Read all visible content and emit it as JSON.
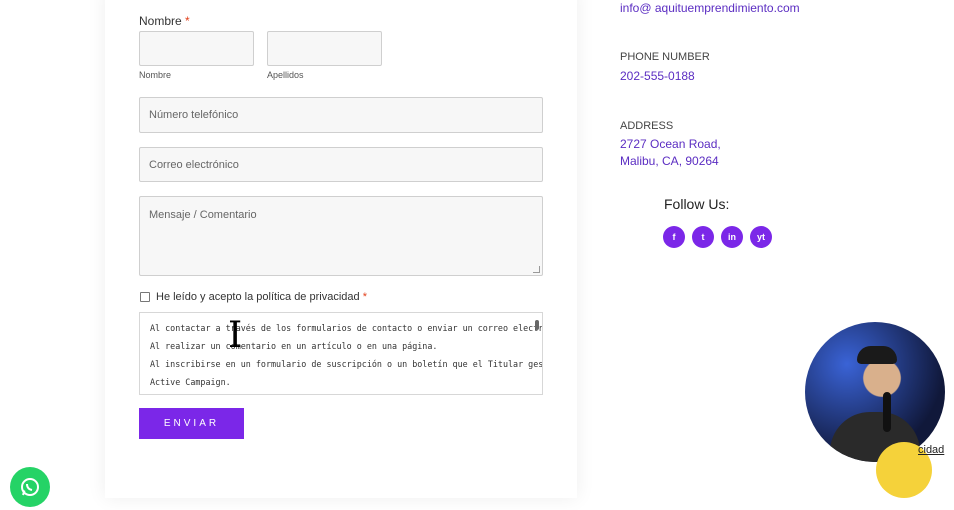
{
  "form": {
    "name_label": "Nombre",
    "required_mark": "*",
    "first_name_sublabel": "Nombre",
    "last_name_sublabel": "Apellidos",
    "phone_placeholder": "Número telefónico",
    "email_placeholder": "Correo electrónico",
    "message_placeholder": "Mensaje / Comentario",
    "privacy_checkbox_label": "He leído y acepto la política de privacidad",
    "policy_lines": [
      "Al contactar a través de los formularios de contacto o enviar un correo electrónico.",
      "Al realizar un comentario en un artículo o en una página.",
      "Al inscribirse en un formulario de suscripción o un boletín que el Titular gestiona con",
      "Active Campaign."
    ],
    "submit_label": "ENVIAR"
  },
  "contact": {
    "email": "info@ aquituemprendimiento.com",
    "phone_caption": "PHONE NUMBER",
    "phone": "202-555-0188",
    "address_caption": "ADDRESS",
    "address_line1": "2727 Ocean Road,",
    "address_line2": "Malibu, CA, 90264"
  },
  "social": {
    "title": "Follow Us:",
    "icons": [
      "f",
      "t",
      "in",
      "yt"
    ]
  },
  "overlay": {
    "link_text": "cidad"
  },
  "colors": {
    "accent": "#7b27e8",
    "link": "#5b2dc2",
    "whatsapp": "#25d366"
  }
}
